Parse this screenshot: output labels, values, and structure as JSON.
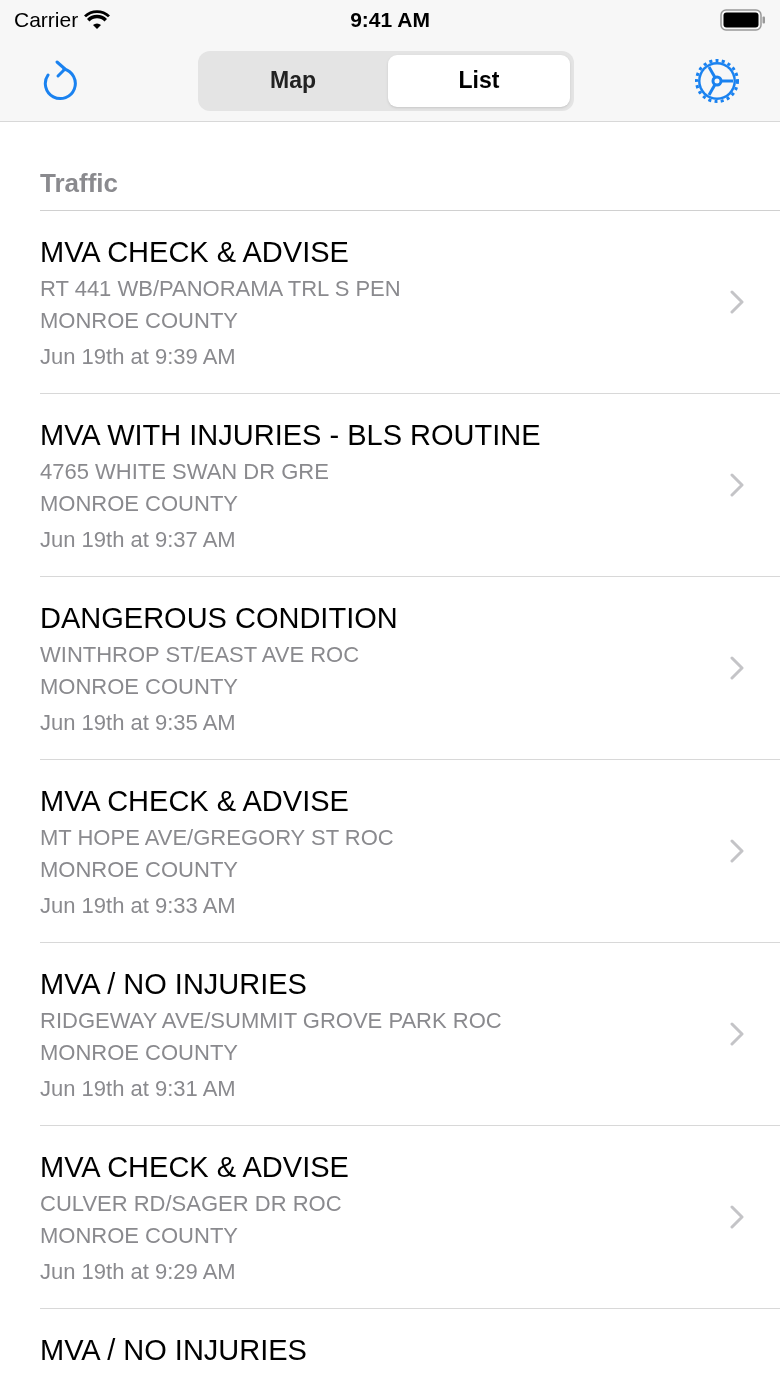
{
  "status_bar": {
    "carrier": "Carrier",
    "time": "9:41 AM"
  },
  "nav": {
    "segments": [
      {
        "label": "Map",
        "selected": false
      },
      {
        "label": "List",
        "selected": true
      }
    ]
  },
  "section": {
    "title": "Traffic"
  },
  "incidents": [
    {
      "title": "MVA CHECK & ADVISE",
      "address": "RT 441 WB/PANORAMA TRL S PEN",
      "county": "MONROE COUNTY",
      "time": "Jun 19th at 9:39 AM"
    },
    {
      "title": "MVA WITH INJURIES - BLS ROUTINE",
      "address": "4765 WHITE SWAN DR GRE",
      "county": "MONROE COUNTY",
      "time": "Jun 19th at 9:37 AM"
    },
    {
      "title": "DANGEROUS CONDITION",
      "address": "WINTHROP ST/EAST AVE ROC",
      "county": "MONROE COUNTY",
      "time": "Jun 19th at 9:35 AM"
    },
    {
      "title": "MVA CHECK & ADVISE",
      "address": "MT HOPE AVE/GREGORY ST ROC",
      "county": "MONROE COUNTY",
      "time": "Jun 19th at 9:33 AM"
    },
    {
      "title": "MVA / NO INJURIES",
      "address": "RIDGEWAY AVE/SUMMIT GROVE PARK ROC",
      "county": "MONROE COUNTY",
      "time": "Jun 19th at 9:31 AM"
    },
    {
      "title": "MVA CHECK & ADVISE",
      "address": "CULVER RD/SAGER DR ROC",
      "county": "MONROE COUNTY",
      "time": "Jun 19th at 9:29 AM"
    },
    {
      "title": "MVA / NO INJURIES"
    }
  ]
}
